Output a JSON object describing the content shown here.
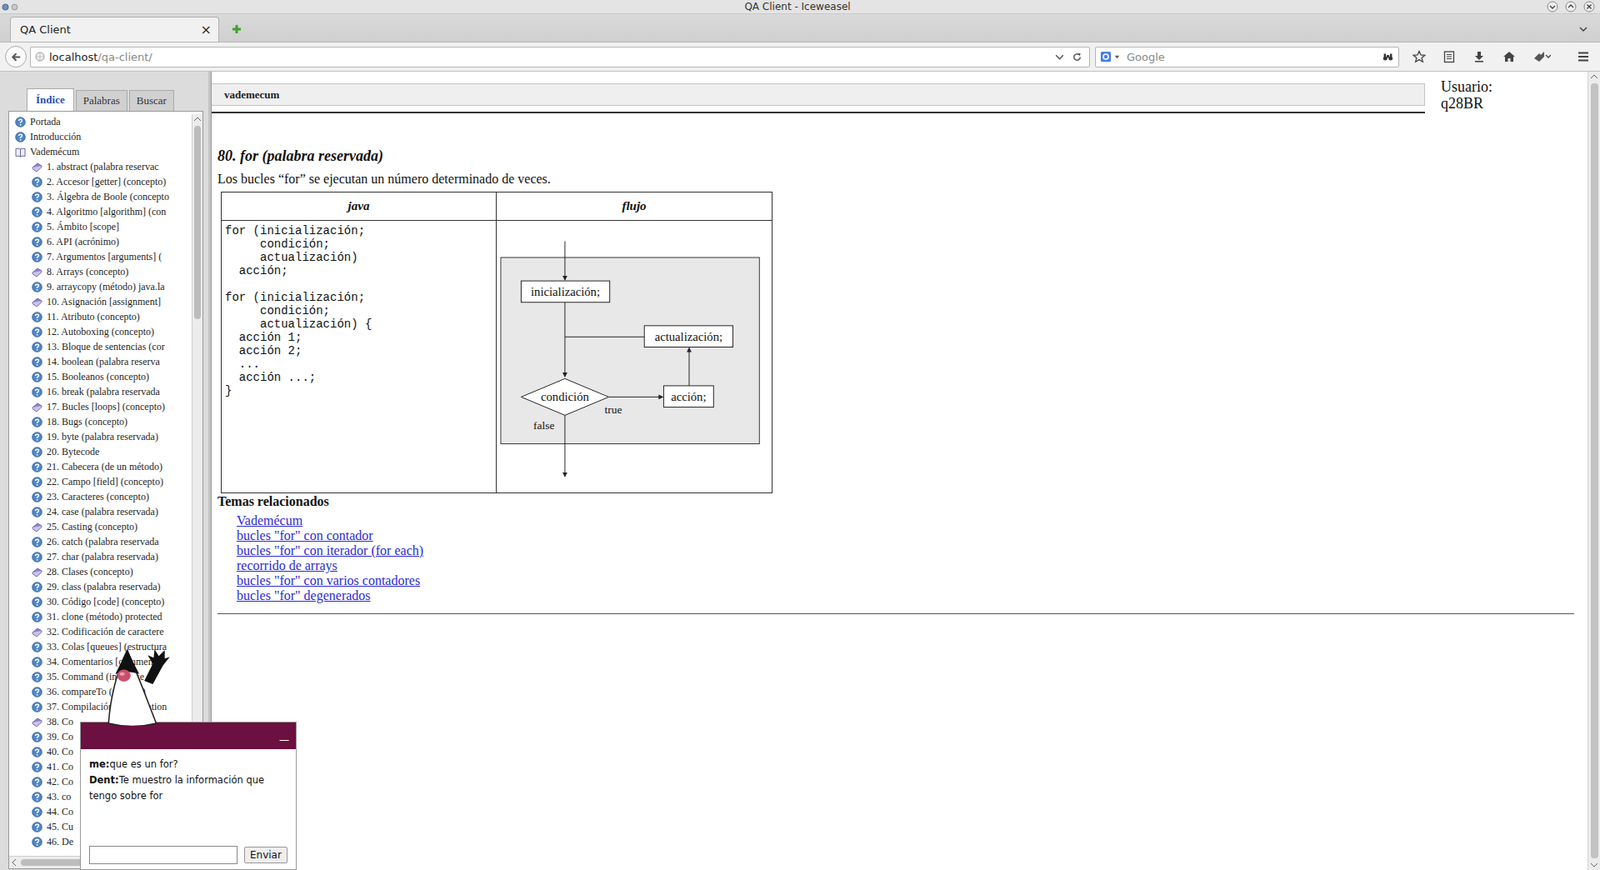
{
  "window": {
    "title": "QA Client - Iceweasel"
  },
  "browser": {
    "tabs": [
      {
        "label": "QA Client",
        "close": "×",
        "selected": true
      }
    ],
    "url_host": "localhost",
    "url_path": "/qa-client/",
    "search_placeholder": "Google"
  },
  "sidebar": {
    "tabs": [
      {
        "label": "Índice",
        "selected": true
      },
      {
        "label": "Palabras",
        "selected": false
      },
      {
        "label": "Buscar",
        "selected": false
      }
    ],
    "items": [
      {
        "label": "Portada",
        "kind": "root"
      },
      {
        "label": "Introducción",
        "kind": "root"
      },
      {
        "label": "Vademécum",
        "kind": "section"
      },
      {
        "label": "1. abstract (palabra reservac",
        "kind": "book"
      },
      {
        "label": "2. Accesor [getter] (concepto)",
        "kind": "page"
      },
      {
        "label": "3. Álgebra de Boole (concepto",
        "kind": "page"
      },
      {
        "label": "4. Algoritmo [algorithm] (con",
        "kind": "page"
      },
      {
        "label": "5. Ámbito [scope]",
        "kind": "page"
      },
      {
        "label": "6. API (acrónimo)",
        "kind": "page"
      },
      {
        "label": "7. Argumentos [arguments] (",
        "kind": "page"
      },
      {
        "label": "8. Arrays (concepto)",
        "kind": "book"
      },
      {
        "label": "9. arraycopy (método) java.la",
        "kind": "page"
      },
      {
        "label": "10. Asignación [assignment]",
        "kind": "book"
      },
      {
        "label": "11. Atributo (concepto)",
        "kind": "page"
      },
      {
        "label": "12. Autoboxing (concepto)",
        "kind": "page"
      },
      {
        "label": "13. Bloque de sentencias (cor",
        "kind": "page"
      },
      {
        "label": "14. boolean (palabra reserva",
        "kind": "page"
      },
      {
        "label": "15. Booleanos (concepto)",
        "kind": "page"
      },
      {
        "label": "16. break (palabra reservada",
        "kind": "page"
      },
      {
        "label": "17. Bucles [loops] (concepto)",
        "kind": "book"
      },
      {
        "label": "18. Bugs (concepto)",
        "kind": "page"
      },
      {
        "label": "19. byte (palabra reservada)",
        "kind": "page"
      },
      {
        "label": "20. Bytecode",
        "kind": "page"
      },
      {
        "label": "21. Cabecera (de un método)",
        "kind": "page"
      },
      {
        "label": "22. Campo [field] (concepto)",
        "kind": "page"
      },
      {
        "label": "23. Caracteres (concepto)",
        "kind": "page"
      },
      {
        "label": "24. case (palabra reservada)",
        "kind": "page"
      },
      {
        "label": "25. Casting (concepto)",
        "kind": "book"
      },
      {
        "label": "26. catch (palabra reservada",
        "kind": "page"
      },
      {
        "label": "27. char (palabra reservada)",
        "kind": "page"
      },
      {
        "label": "28. Clases (concepto)",
        "kind": "book"
      },
      {
        "label": "29. class (palabra reservada)",
        "kind": "page"
      },
      {
        "label": "30. Código [code] (concepto)",
        "kind": "page"
      },
      {
        "label": "31. clone (método) protected",
        "kind": "page"
      },
      {
        "label": "32. Codificación de caractere",
        "kind": "book"
      },
      {
        "label": "33. Colas [queues] (estructura",
        "kind": "page"
      },
      {
        "label": "34. Comentarios [comments]",
        "kind": "page"
      },
      {
        "label": "35. Command (interface",
        "kind": "page"
      },
      {
        "label": "36. compareTo (método)",
        "kind": "page"
      },
      {
        "label": "37. Compilación [compilation",
        "kind": "page"
      },
      {
        "label": "38. Co",
        "kind": "book"
      },
      {
        "label": "39. Co",
        "kind": "page"
      },
      {
        "label": "40. Co",
        "kind": "page"
      },
      {
        "label": "41. Co",
        "kind": "page"
      },
      {
        "label": "42. Co",
        "kind": "page"
      },
      {
        "label": "43. co",
        "kind": "page"
      },
      {
        "label": "44. Co",
        "kind": "page"
      },
      {
        "label": "45. Cu",
        "kind": "page"
      },
      {
        "label": "46. De",
        "kind": "page"
      }
    ]
  },
  "header": {
    "title": "vademecum"
  },
  "user": {
    "label": "Usuario:",
    "name": "q28BR"
  },
  "article": {
    "title": "80. for (palabra reservada)",
    "intro": "Los bucles “for” se ejecutan un número determinado de veces.",
    "columns": [
      "java",
      "flujo"
    ],
    "code": "for (inicialización;\n     condición;\n     actualización)\n  acción;\n\nfor (inicialización;\n     condición;\n     actualización) {\n  acción 1;\n  acción 2;\n  ...\n  acción ...;\n}",
    "diagram": {
      "init": "inicialización;",
      "update": "actualización;",
      "condition": "condición",
      "action": "acción;",
      "true_label": "true",
      "false_label": "false"
    },
    "related_title": "Temas relacionados",
    "related": [
      "Vademécum",
      "bucles \"for\" con contador",
      "bucles \"for\" con iterador (for each)",
      "recorrido de arrays",
      "bucles \"for\" con varios contadores",
      "bucles \"for\" degenerados"
    ]
  },
  "chat": {
    "minimize": "—",
    "messages": [
      {
        "sender": "me:",
        "text": "que es un for?"
      },
      {
        "sender": "Dent:",
        "text": "Te muestro la información que tengo sobre for"
      }
    ],
    "input_value": "",
    "button": "Enviar"
  }
}
